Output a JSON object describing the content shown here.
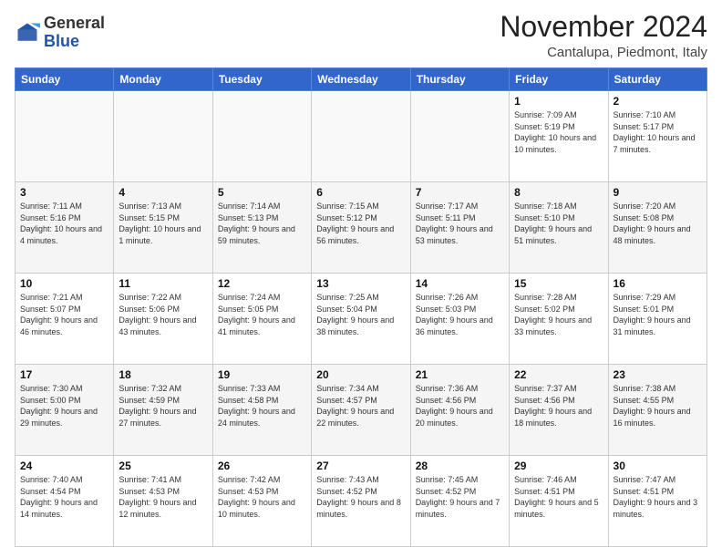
{
  "logo": {
    "general": "General",
    "blue": "Blue"
  },
  "header": {
    "month_title": "November 2024",
    "location": "Cantalupa, Piedmont, Italy"
  },
  "weekdays": [
    "Sunday",
    "Monday",
    "Tuesday",
    "Wednesday",
    "Thursday",
    "Friday",
    "Saturday"
  ],
  "weeks": [
    [
      {
        "day": "",
        "info": ""
      },
      {
        "day": "",
        "info": ""
      },
      {
        "day": "",
        "info": ""
      },
      {
        "day": "",
        "info": ""
      },
      {
        "day": "",
        "info": ""
      },
      {
        "day": "1",
        "info": "Sunrise: 7:09 AM\nSunset: 5:19 PM\nDaylight: 10 hours and 10 minutes."
      },
      {
        "day": "2",
        "info": "Sunrise: 7:10 AM\nSunset: 5:17 PM\nDaylight: 10 hours and 7 minutes."
      }
    ],
    [
      {
        "day": "3",
        "info": "Sunrise: 7:11 AM\nSunset: 5:16 PM\nDaylight: 10 hours and 4 minutes."
      },
      {
        "day": "4",
        "info": "Sunrise: 7:13 AM\nSunset: 5:15 PM\nDaylight: 10 hours and 1 minute."
      },
      {
        "day": "5",
        "info": "Sunrise: 7:14 AM\nSunset: 5:13 PM\nDaylight: 9 hours and 59 minutes."
      },
      {
        "day": "6",
        "info": "Sunrise: 7:15 AM\nSunset: 5:12 PM\nDaylight: 9 hours and 56 minutes."
      },
      {
        "day": "7",
        "info": "Sunrise: 7:17 AM\nSunset: 5:11 PM\nDaylight: 9 hours and 53 minutes."
      },
      {
        "day": "8",
        "info": "Sunrise: 7:18 AM\nSunset: 5:10 PM\nDaylight: 9 hours and 51 minutes."
      },
      {
        "day": "9",
        "info": "Sunrise: 7:20 AM\nSunset: 5:08 PM\nDaylight: 9 hours and 48 minutes."
      }
    ],
    [
      {
        "day": "10",
        "info": "Sunrise: 7:21 AM\nSunset: 5:07 PM\nDaylight: 9 hours and 46 minutes."
      },
      {
        "day": "11",
        "info": "Sunrise: 7:22 AM\nSunset: 5:06 PM\nDaylight: 9 hours and 43 minutes."
      },
      {
        "day": "12",
        "info": "Sunrise: 7:24 AM\nSunset: 5:05 PM\nDaylight: 9 hours and 41 minutes."
      },
      {
        "day": "13",
        "info": "Sunrise: 7:25 AM\nSunset: 5:04 PM\nDaylight: 9 hours and 38 minutes."
      },
      {
        "day": "14",
        "info": "Sunrise: 7:26 AM\nSunset: 5:03 PM\nDaylight: 9 hours and 36 minutes."
      },
      {
        "day": "15",
        "info": "Sunrise: 7:28 AM\nSunset: 5:02 PM\nDaylight: 9 hours and 33 minutes."
      },
      {
        "day": "16",
        "info": "Sunrise: 7:29 AM\nSunset: 5:01 PM\nDaylight: 9 hours and 31 minutes."
      }
    ],
    [
      {
        "day": "17",
        "info": "Sunrise: 7:30 AM\nSunset: 5:00 PM\nDaylight: 9 hours and 29 minutes."
      },
      {
        "day": "18",
        "info": "Sunrise: 7:32 AM\nSunset: 4:59 PM\nDaylight: 9 hours and 27 minutes."
      },
      {
        "day": "19",
        "info": "Sunrise: 7:33 AM\nSunset: 4:58 PM\nDaylight: 9 hours and 24 minutes."
      },
      {
        "day": "20",
        "info": "Sunrise: 7:34 AM\nSunset: 4:57 PM\nDaylight: 9 hours and 22 minutes."
      },
      {
        "day": "21",
        "info": "Sunrise: 7:36 AM\nSunset: 4:56 PM\nDaylight: 9 hours and 20 minutes."
      },
      {
        "day": "22",
        "info": "Sunrise: 7:37 AM\nSunset: 4:56 PM\nDaylight: 9 hours and 18 minutes."
      },
      {
        "day": "23",
        "info": "Sunrise: 7:38 AM\nSunset: 4:55 PM\nDaylight: 9 hours and 16 minutes."
      }
    ],
    [
      {
        "day": "24",
        "info": "Sunrise: 7:40 AM\nSunset: 4:54 PM\nDaylight: 9 hours and 14 minutes."
      },
      {
        "day": "25",
        "info": "Sunrise: 7:41 AM\nSunset: 4:53 PM\nDaylight: 9 hours and 12 minutes."
      },
      {
        "day": "26",
        "info": "Sunrise: 7:42 AM\nSunset: 4:53 PM\nDaylight: 9 hours and 10 minutes."
      },
      {
        "day": "27",
        "info": "Sunrise: 7:43 AM\nSunset: 4:52 PM\nDaylight: 9 hours and 8 minutes."
      },
      {
        "day": "28",
        "info": "Sunrise: 7:45 AM\nSunset: 4:52 PM\nDaylight: 9 hours and 7 minutes."
      },
      {
        "day": "29",
        "info": "Sunrise: 7:46 AM\nSunset: 4:51 PM\nDaylight: 9 hours and 5 minutes."
      },
      {
        "day": "30",
        "info": "Sunrise: 7:47 AM\nSunset: 4:51 PM\nDaylight: 9 hours and 3 minutes."
      }
    ]
  ]
}
